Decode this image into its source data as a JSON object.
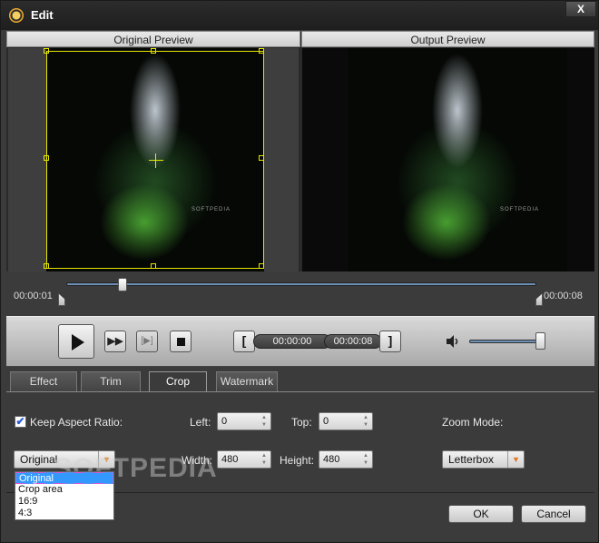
{
  "window": {
    "title": "Edit",
    "close_label": "X"
  },
  "preview": {
    "original_label": "Original Preview",
    "output_label": "Output Preview",
    "video_watermark": "SOFTPEDIA"
  },
  "timeline": {
    "start_time": "00:00:01",
    "end_time": "00:00:08",
    "position_fraction": 0.12
  },
  "controls": {
    "fast_forward_label": "▶▶",
    "frame_step_label": "[▶]",
    "bracket_start_label": "[",
    "bracket_end_label": "]",
    "clip_start_time": "00:00:00",
    "clip_end_time": "00:00:08",
    "volume_level": 0.95
  },
  "tabs": [
    {
      "label": "Effect",
      "active": false
    },
    {
      "label": "Trim",
      "active": false
    },
    {
      "label": "Crop",
      "active": true
    },
    {
      "label": "Watermark",
      "active": false
    }
  ],
  "crop": {
    "keep_aspect_label": "Keep Aspect Ratio:",
    "keep_aspect_checked": true,
    "checkbox_mark": "✔",
    "left_label": "Left:",
    "left_value": "0",
    "top_label": "Top:",
    "top_value": "0",
    "width_label": "Width:",
    "width_value": "480",
    "height_label": "Height:",
    "height_value": "480",
    "zoom_mode_label": "Zoom Mode:",
    "zoom_mode_value": "Letterbox",
    "aspect_select_value": "Original",
    "aspect_options": [
      "Original",
      "Crop area",
      "16:9",
      "4:3"
    ],
    "spin_up": "▲",
    "spin_down": "▼",
    "select_arrow": "▼"
  },
  "overlay_watermark": "SOFTPEDIA",
  "footer": {
    "ok_label": "OK",
    "cancel_label": "Cancel"
  },
  "colors": {
    "crop_frame": "#e6e600",
    "track": "#6d8fb5",
    "select_arrow": "#e0771c",
    "dropdown_highlight": "#3399ff"
  }
}
